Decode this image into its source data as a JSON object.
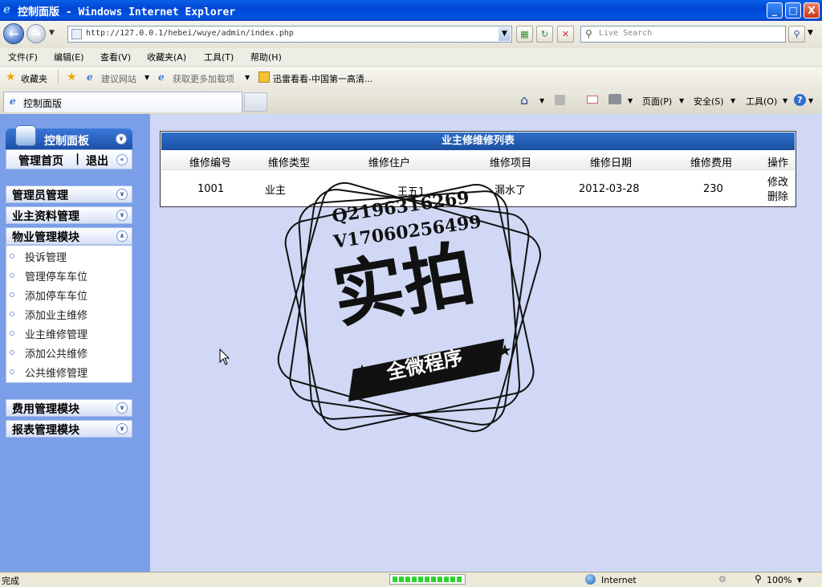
{
  "window": {
    "title": "控制面版 - Windows Internet Explorer",
    "minimize_glyph": "_",
    "maximize_glyph": "□",
    "close_glyph": "X"
  },
  "address": {
    "url": "http://127.0.0.1/hebei/wuye/admin/index.php"
  },
  "search": {
    "placeholder": "Live Search"
  },
  "menu": [
    "文件(F)",
    "编辑(E)",
    "查看(V)",
    "收藏夹(A)",
    "工具(T)",
    "帮助(H)"
  ],
  "favorites": {
    "label": "收藏夹",
    "items": [
      "建议网站",
      "获取更多加载项",
      "迅雷看看-中国第一高清..."
    ]
  },
  "tab": {
    "label": "控制面版"
  },
  "commandbar": {
    "page": "页面(P)",
    "safety": "安全(S)",
    "tools": "工具(O)"
  },
  "sidebar": {
    "header": "控制面板",
    "home_link": "管理首页",
    "separator": "|",
    "logout_link": "退出",
    "sections": [
      {
        "label": "管理员管理"
      },
      {
        "label": "业主资料管理"
      },
      {
        "label": "物业管理模块",
        "items": [
          "投诉管理",
          "管理停车车位",
          "添加停车车位",
          "添加业主维修",
          "业主维修管理",
          "添加公共维修",
          "公共维修管理"
        ]
      },
      {
        "label": "费用管理模块"
      },
      {
        "label": "报表管理模块"
      }
    ]
  },
  "table": {
    "title": "业主修维修列表",
    "columns": [
      "维修编号",
      "维修类型",
      "维修住户",
      "维修项目",
      "维修日期",
      "维修费用",
      "操作"
    ],
    "rows": [
      {
        "id": "1001",
        "type": "业主",
        "resident": "王五1",
        "item": "漏水了",
        "date": "2012-03-28",
        "fee": "230",
        "edit": "修改",
        "delete": "删除"
      }
    ]
  },
  "watermark": {
    "line1": "Q2196316269",
    "line2": "V17060256499",
    "big": "实拍",
    "ribbon": "全微程序"
  },
  "status": {
    "text": "完成",
    "zone": "Internet",
    "zoom": "100%"
  },
  "colors": {
    "title_bar": "#0054E3",
    "sidebar": "#7A9EE8",
    "content_bg": "#D0D8F5",
    "table_header": "#1A4FA0"
  }
}
